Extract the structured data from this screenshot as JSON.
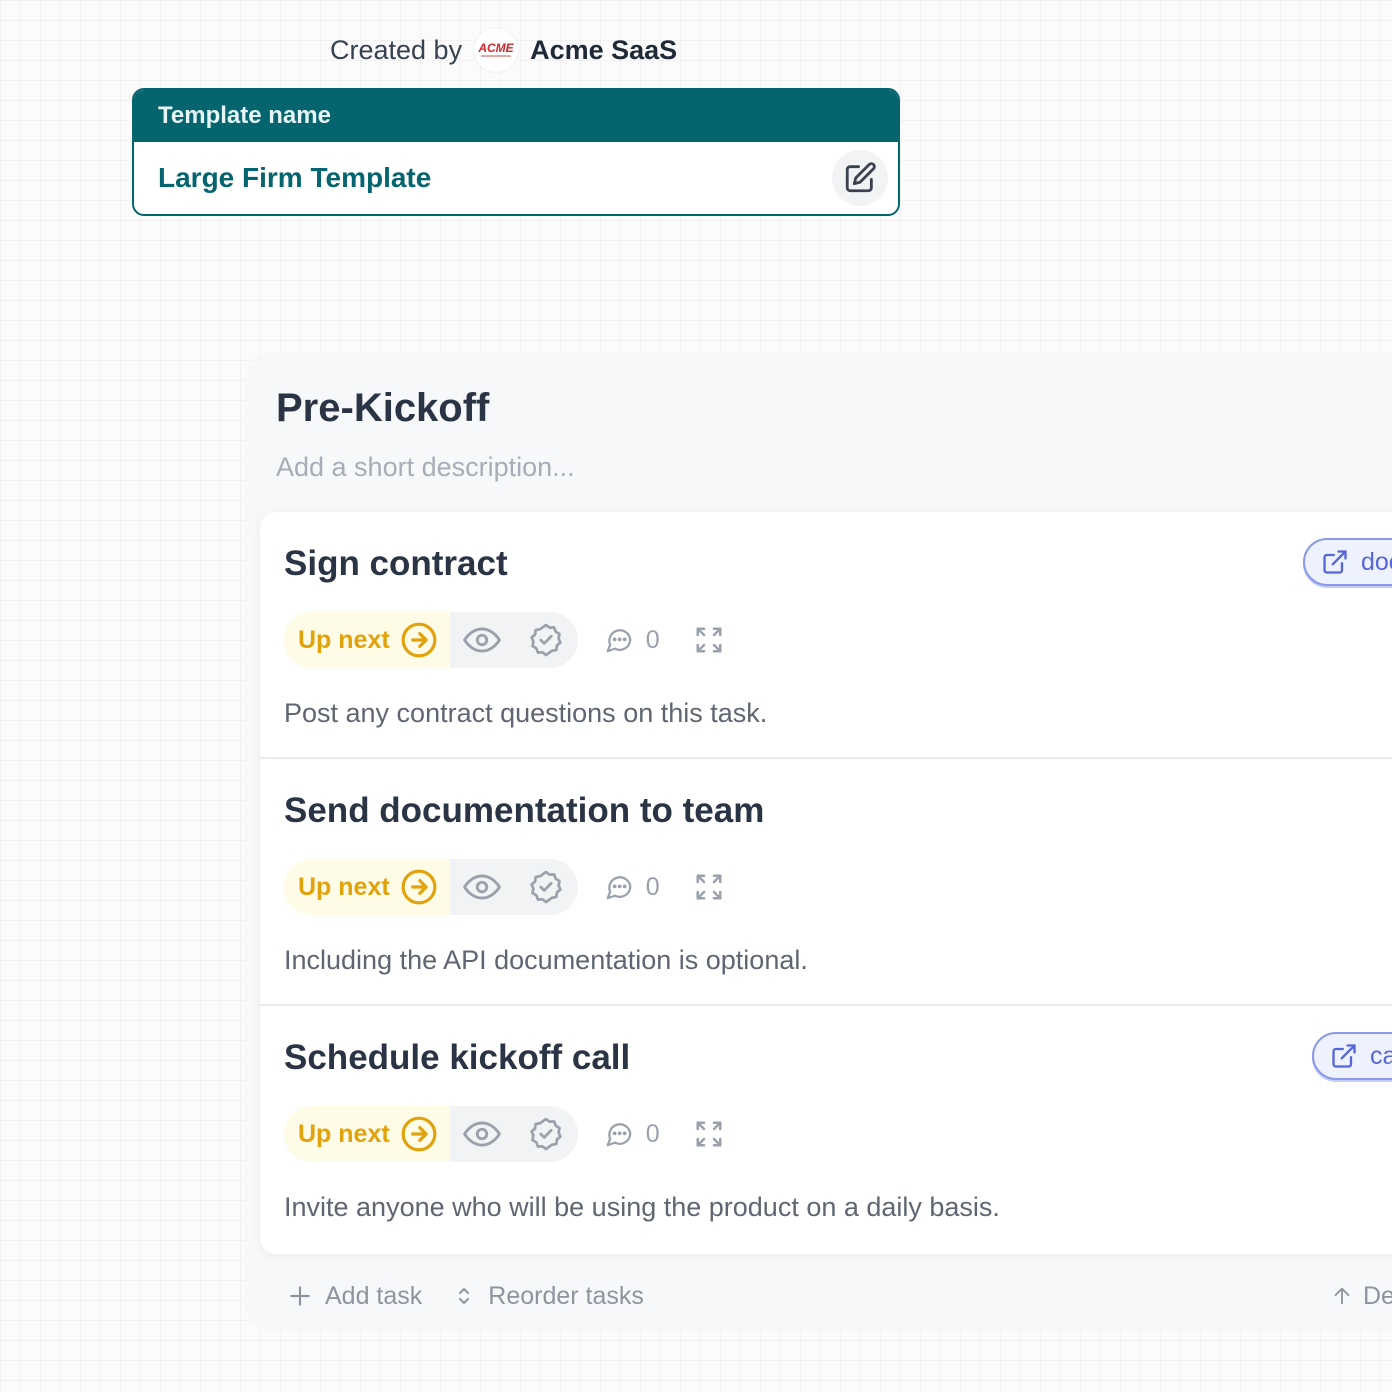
{
  "created_by": {
    "label": "Created by",
    "logo_text": "ACME",
    "company": "Acme SaaS"
  },
  "template": {
    "header": "Template name",
    "name": "Large Firm Template",
    "edit_icon": "edit-icon"
  },
  "section": {
    "title": "Pre-Kickoff",
    "description_placeholder": "Add a short description...",
    "tasks": [
      {
        "title": "Sign contract",
        "status": "Up next",
        "comment_count": "0",
        "description": "Post any contract questions on this task.",
        "link_label": "doc"
      },
      {
        "title": "Send documentation to team",
        "status": "Up next",
        "comment_count": "0",
        "description": "Including the API documentation is optional."
      },
      {
        "title": "Schedule kickoff call",
        "status": "Up next",
        "comment_count": "0",
        "description": "Invite anyone who will be using the product on a daily basis.",
        "link_label": "ca"
      }
    ],
    "footer": {
      "add_task": "Add task",
      "reorder_tasks": "Reorder tasks",
      "right_action": "De"
    }
  },
  "colors": {
    "brand_teal": "#05656f",
    "up_next": "#e1a20c",
    "link_accent": "#5667db"
  }
}
